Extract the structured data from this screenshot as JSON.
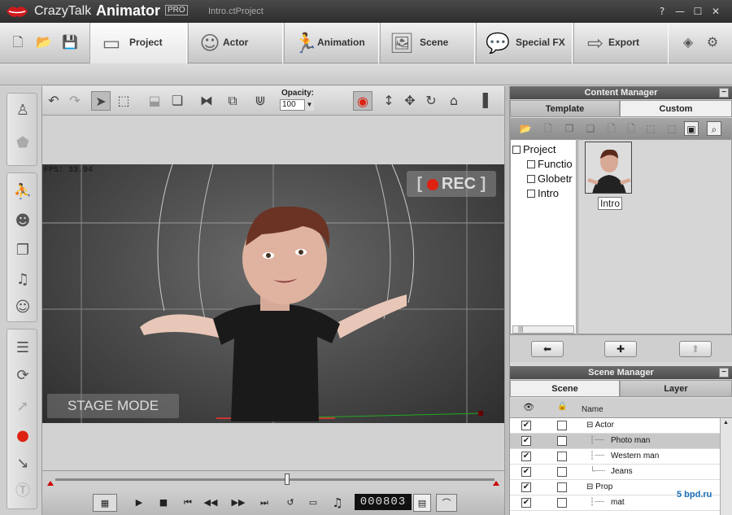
{
  "app": {
    "name_part1": "CrazyTalk",
    "name_part2": "Animator",
    "edition": "PRO",
    "file": "Intro.ctProject"
  },
  "window_controls": {
    "help": "?",
    "minimize": "—",
    "maximize": "☐",
    "close": "✕"
  },
  "main_tabs": [
    {
      "label": "Project",
      "icon": "project-icon"
    },
    {
      "label": "Actor",
      "icon": "actor-icon"
    },
    {
      "label": "Animation",
      "icon": "animation-icon"
    },
    {
      "label": "Scene",
      "icon": "scene-icon"
    },
    {
      "label": "Special FX",
      "icon": "special-fx-icon"
    },
    {
      "label": "Export",
      "icon": "export-icon"
    }
  ],
  "stage_toolbar": {
    "opacity_label": "Opacity:",
    "opacity_value": "100"
  },
  "stage": {
    "fps_text": "FPS: 33.94",
    "rec_label": "REC",
    "mode_label": "STAGE MODE"
  },
  "playback": {
    "frame": "000803"
  },
  "content_manager": {
    "title": "Content Manager",
    "tabs": [
      "Template",
      "Custom"
    ],
    "active_tab": "Custom",
    "tree": [
      "Project",
      "Functio",
      "Globetr",
      "Intro"
    ],
    "scroll_mark": "|||",
    "item": {
      "label": "Intro"
    }
  },
  "scene_manager": {
    "title": "Scene Manager",
    "tabs": [
      "Scene",
      "Layer"
    ],
    "active_tab": "Scene",
    "column_name": "Name",
    "rows": [
      {
        "name": "Actor",
        "type": "group",
        "visible": true,
        "locked": false
      },
      {
        "name": "Photo man",
        "type": "child",
        "visible": true,
        "locked": false,
        "selected": true
      },
      {
        "name": "Western man",
        "type": "child",
        "visible": true,
        "locked": false
      },
      {
        "name": "Jeans",
        "type": "child",
        "visible": true,
        "locked": false
      },
      {
        "name": "Prop",
        "type": "group",
        "visible": true,
        "locked": false
      },
      {
        "name": "mat",
        "type": "child",
        "visible": true,
        "locked": false
      }
    ]
  },
  "watermark": "5 bpd.ru",
  "colors": {
    "title_bg": "#3a3a3a",
    "stage_bg": "#4a4a4a",
    "rec_red": "#d21a1a",
    "accent_blue": "#1a6fb8"
  }
}
